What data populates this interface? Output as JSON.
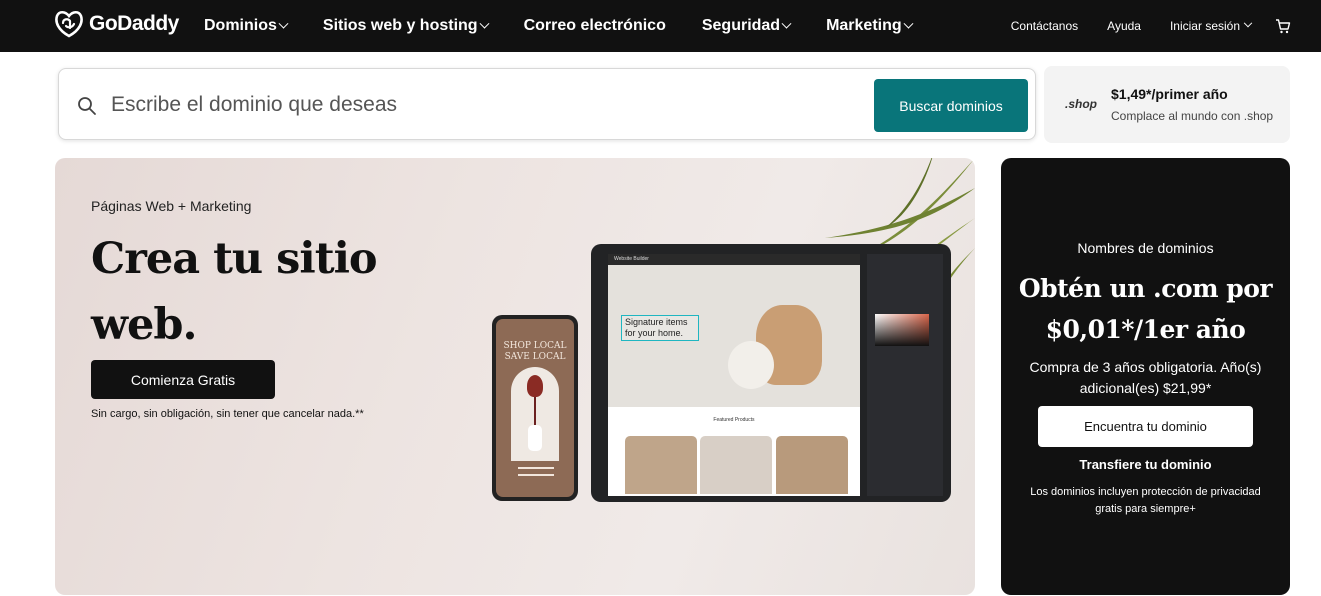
{
  "nav": {
    "logo": "GoDaddy",
    "items": [
      {
        "label": "Dominios",
        "dropdown": true
      },
      {
        "label": "Sitios web y hosting",
        "dropdown": true
      },
      {
        "label": "Correo electrónico",
        "dropdown": false
      },
      {
        "label": "Seguridad",
        "dropdown": true
      },
      {
        "label": "Marketing",
        "dropdown": true
      }
    ],
    "contact": "Contáctanos",
    "help": "Ayuda",
    "signin": "Iniciar sesión",
    "cart_icon": "cart-icon"
  },
  "search": {
    "placeholder": "Escribe el dominio que deseas",
    "button": "Buscar dominios",
    "icon": "search-icon"
  },
  "promo": {
    "tld": ".shop",
    "price": "$1,49*/primer año",
    "subtitle": "Complace al mundo con .shop"
  },
  "hero": {
    "eyebrow": "Páginas Web + Marketing",
    "title": "Crea tu sitio web.",
    "button": "Comienza Gratis",
    "note": "Sin cargo, sin obligación, sin tener que cancelar nada.**",
    "phone_text": "SHOP LOCAL SAVE LOCAL",
    "tablet_brand": "Website Builder",
    "tablet_signature": "Signature items for your home.",
    "tablet_products": "Featured Products"
  },
  "card": {
    "eyebrow": "Nombres de dominios",
    "title": "Obtén un .com por $0,01*/1er año",
    "description": "Compra de 3 años obligatoria. Año(s) adicional(es) $21,99*",
    "button": "Encuentra tu dominio",
    "link": "Transfiere tu dominio",
    "note": "Los dominios incluyen protección de privacidad gratis para siempre+"
  },
  "colors": {
    "nav_bg": "#111111",
    "search_button": "#09757a",
    "hero_bg": "#ede4e1",
    "card_bg": "#111111"
  }
}
